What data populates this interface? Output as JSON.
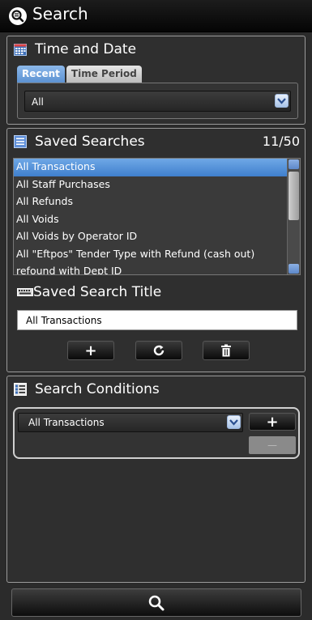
{
  "header": {
    "title": "Search"
  },
  "time_date": {
    "title": "Time and Date",
    "tabs": [
      {
        "label": "Recent"
      },
      {
        "label": "Time Period"
      }
    ],
    "selected_value": "All"
  },
  "saved_searches": {
    "title": "Saved Searches",
    "count": "11/50",
    "items": [
      {
        "label": "All Transactions"
      },
      {
        "label": "All Staff Purchases"
      },
      {
        "label": "All Refunds"
      },
      {
        "label": "All Voids"
      },
      {
        "label": "All Voids by Operator ID"
      },
      {
        "label": "All \"Eftpos\" Tender Type with Refund (cash out)"
      },
      {
        "label": "refound with Dept ID"
      }
    ],
    "selected_index": 0,
    "title_label": "Saved Search Title",
    "title_value": "All Transactions",
    "buttons": {
      "add": "+"
    }
  },
  "conditions": {
    "title": "Search Conditions",
    "selected_value": "All Transactions",
    "add_label": "+",
    "remove_label": "—"
  },
  "colors": {
    "accent": "#5c92d2",
    "panel_border": "#9a9a9a",
    "background": "#2b2b2b"
  }
}
